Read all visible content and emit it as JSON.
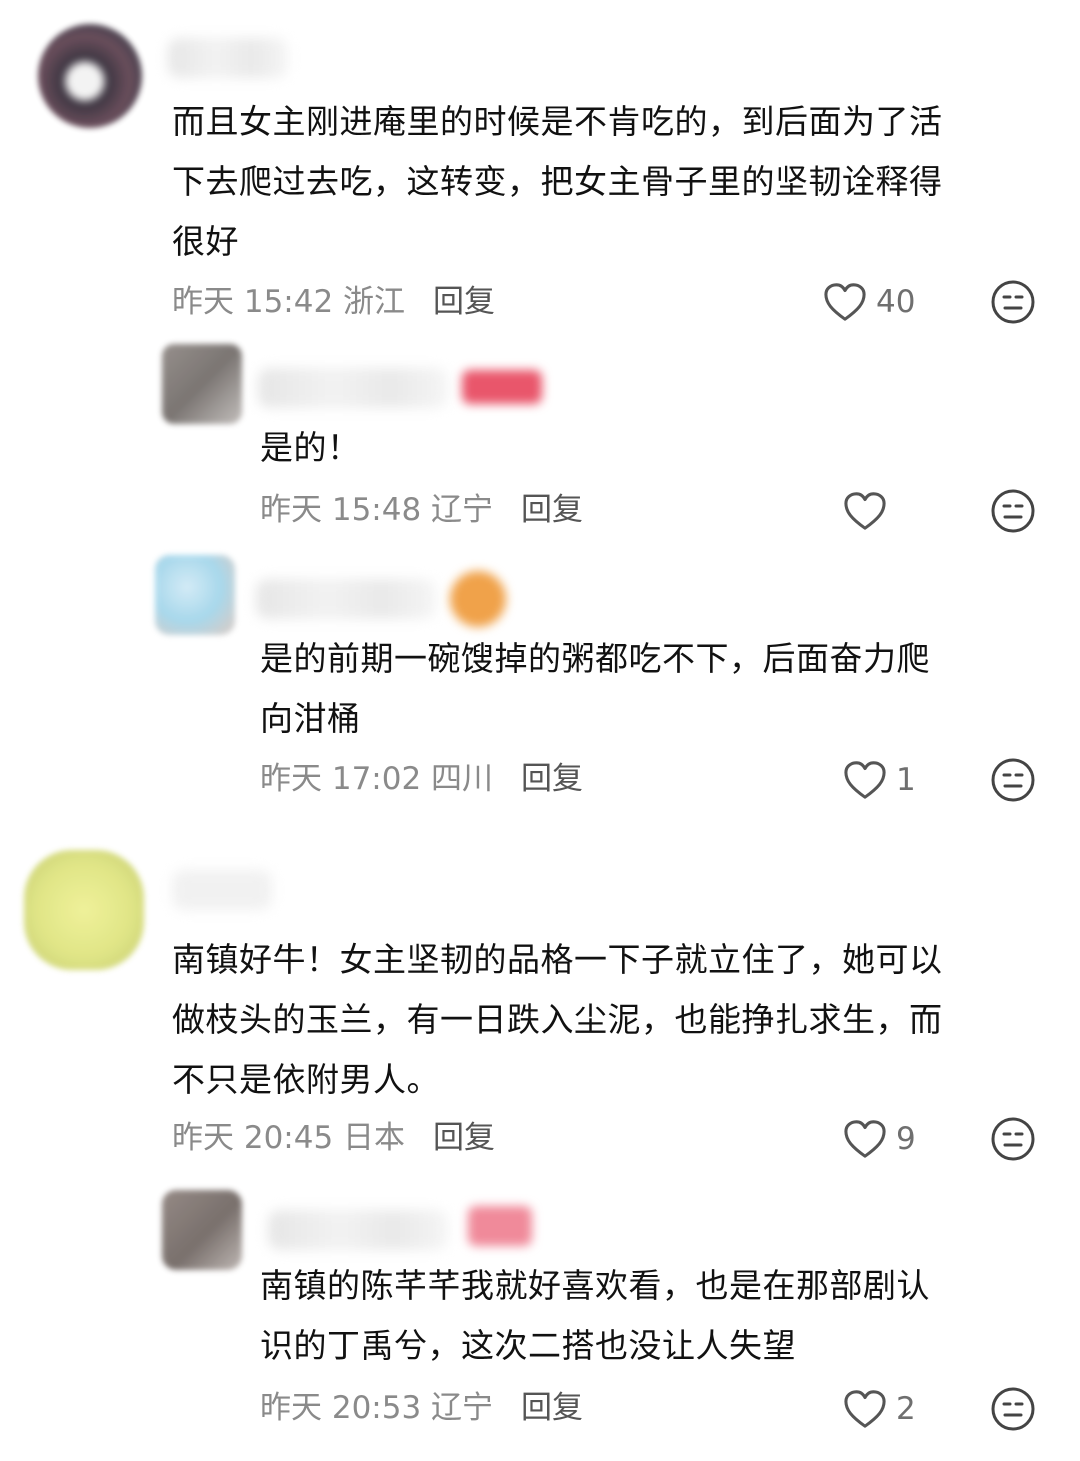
{
  "comments": [
    {
      "text": "而且女主刚进庵里的时候是不肯吃的，到后面为了活\n下去爬过去吃，这转变，把女主骨子里的坚韧诠释得\n很好",
      "time": "昨天 15:42 浙江",
      "reply_label": "回复",
      "likes": "40",
      "avatar_color": "#3b2f3a"
    },
    {
      "text": "是的！",
      "time": "昨天 15:48 辽宁",
      "reply_label": "回复",
      "likes": "",
      "avatar_color": "#6f6a66",
      "tag_color": "#e9566b"
    },
    {
      "text": "是的前期一碗馊掉的粥都吃不下，后面奋力爬\n向泔桶",
      "time": "昨天 17:02 四川",
      "reply_label": "回复",
      "likes": "1",
      "avatar_color": "#9fd4ea",
      "tag_color": "#f0a24a"
    },
    {
      "text": "南镇好牛！女主坚韧的品格一下子就立住了，她可以\n做枝头的玉兰，有一日跌入尘泥，也能挣扎求生，而\n不只是依附男人。",
      "time": "昨天 20:45 日本",
      "reply_label": "回复",
      "likes": "9",
      "avatar_color": "#dde37a"
    },
    {
      "text": "南镇的陈芊芊我就好喜欢看，也是在那部剧认\n识的丁禹兮，这次二搭也没让人失望",
      "time": "昨天 20:53 辽宁",
      "reply_label": "回复",
      "likes": "2",
      "avatar_color": "#7b6f6b",
      "tag_color": "#f08a9a"
    }
  ],
  "icons": {
    "like": "heart-outline-icon",
    "dislike": "neutral-face-icon"
  }
}
